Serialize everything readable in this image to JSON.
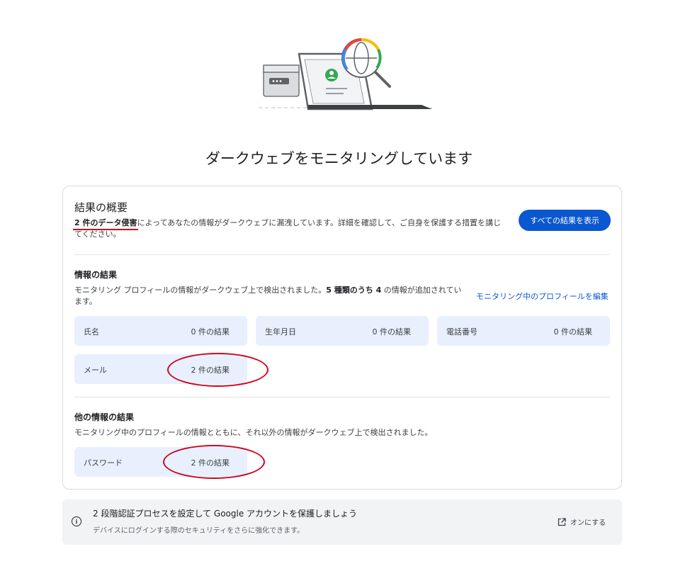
{
  "page_title": "ダークウェブをモニタリングしています",
  "summary": {
    "title": "結果の概要",
    "desc_bold": "2 件のデータ侵害",
    "desc_rest": "によってあなたの情報がダークウェブに漏洩しています。詳細を確認して、ご自身を保護する措置を講じてください。",
    "show_all_label": "すべての結果を表示"
  },
  "info_results": {
    "title": "情報の結果",
    "desc_prefix": "モニタリング プロフィールの情報がダークウェブ上で検出されました。",
    "desc_bold": "5 種類のうち 4",
    "desc_suffix": " の情報が追加されています。",
    "edit_link": "モニタリング中のプロフィールを編集",
    "tiles": [
      {
        "label": "氏名",
        "count": "0 件の結果"
      },
      {
        "label": "生年月日",
        "count": "0 件の結果"
      },
      {
        "label": "電話番号",
        "count": "0 件の結果"
      },
      {
        "label": "メール",
        "count": "2 件の結果"
      }
    ]
  },
  "other_results": {
    "title": "他の情報の結果",
    "desc": "モニタリング中のプロフィールの情報とともに、それ以外の情報がダークウェブ上で検出されました。",
    "tiles": [
      {
        "label": "パスワード",
        "count": "2 件の結果"
      }
    ]
  },
  "banner": {
    "icon": "info-icon",
    "title": "2 段階認証プロセスを設定して Google アカウントを保護しましょう",
    "desc": "デバイスにログインする際のセキュリティをさらに強化できます。",
    "action_label": "オンにする",
    "action_icon": "open-in-new-icon"
  },
  "colors": {
    "primary_button": "#0b57d0",
    "link": "#0b57d0",
    "tile_bg": "#e8f0fe",
    "annotation_red": "#d0021b"
  }
}
